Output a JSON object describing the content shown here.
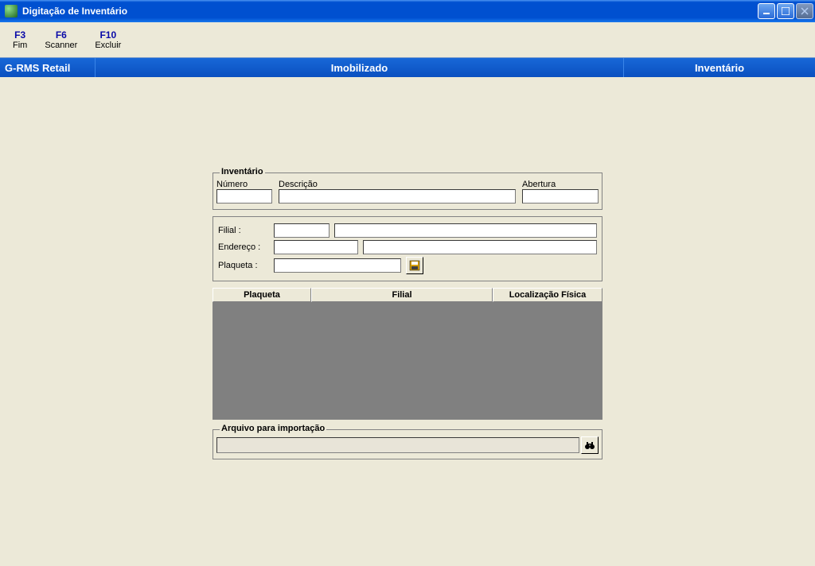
{
  "window": {
    "title": "Digitação de Inventário"
  },
  "toolbar": {
    "items": [
      {
        "key": "F3",
        "label": "Fim"
      },
      {
        "key": "F6",
        "label": "Scanner"
      },
      {
        "key": "F10",
        "label": "Excluir"
      }
    ]
  },
  "navbar": {
    "left": "G-RMS Retail",
    "center": "Imobilizado",
    "right": "Inventário"
  },
  "inventario_fieldset": {
    "legend": "Inventário",
    "numero_label": "Número",
    "descricao_label": "Descrição",
    "abertura_label": "Abertura",
    "numero_value": "",
    "descricao_value": "",
    "abertura_value": ""
  },
  "details": {
    "filial_label": "Filial :",
    "endereco_label": "Endereço :",
    "plaqueta_label": "Plaqueta :",
    "filial_code": "",
    "filial_name": "",
    "endereco_code": "",
    "endereco_name": "",
    "plaqueta_value": ""
  },
  "table": {
    "headers": {
      "plaqueta": "Plaqueta",
      "filial": "Filial",
      "localizacao": "Localização Física"
    },
    "rows": []
  },
  "import": {
    "legend": "Arquivo para importação",
    "path": ""
  }
}
